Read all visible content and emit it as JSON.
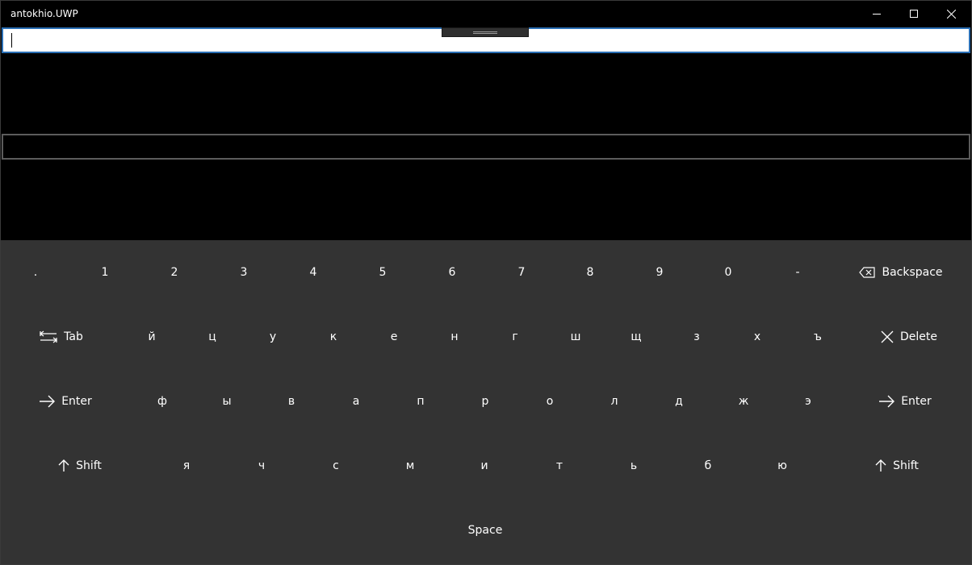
{
  "window": {
    "title": "antokhio.UWP"
  },
  "keyboard": {
    "row1": [
      ".",
      "1",
      "2",
      "3",
      "4",
      "5",
      "6",
      "7",
      "8",
      "9",
      "0",
      "-"
    ],
    "backspace_label": "Backspace",
    "tab_label": "Tab",
    "row2": [
      "й",
      "ц",
      "у",
      "к",
      "е",
      "н",
      "г",
      "ш",
      "щ",
      "з",
      "х",
      "ъ"
    ],
    "delete_label": "Delete",
    "enter_left_label": "Enter",
    "row3": [
      "ф",
      "ы",
      "в",
      "а",
      "п",
      "р",
      "о",
      "л",
      "д",
      "ж",
      "э"
    ],
    "enter_right_label": "Enter",
    "shift_left_label": "Shift",
    "row4": [
      "я",
      "ч",
      "с",
      "м",
      "и",
      "т",
      "ь",
      "б",
      "ю"
    ],
    "shift_right_label": "Shift",
    "space_label": "Space"
  }
}
